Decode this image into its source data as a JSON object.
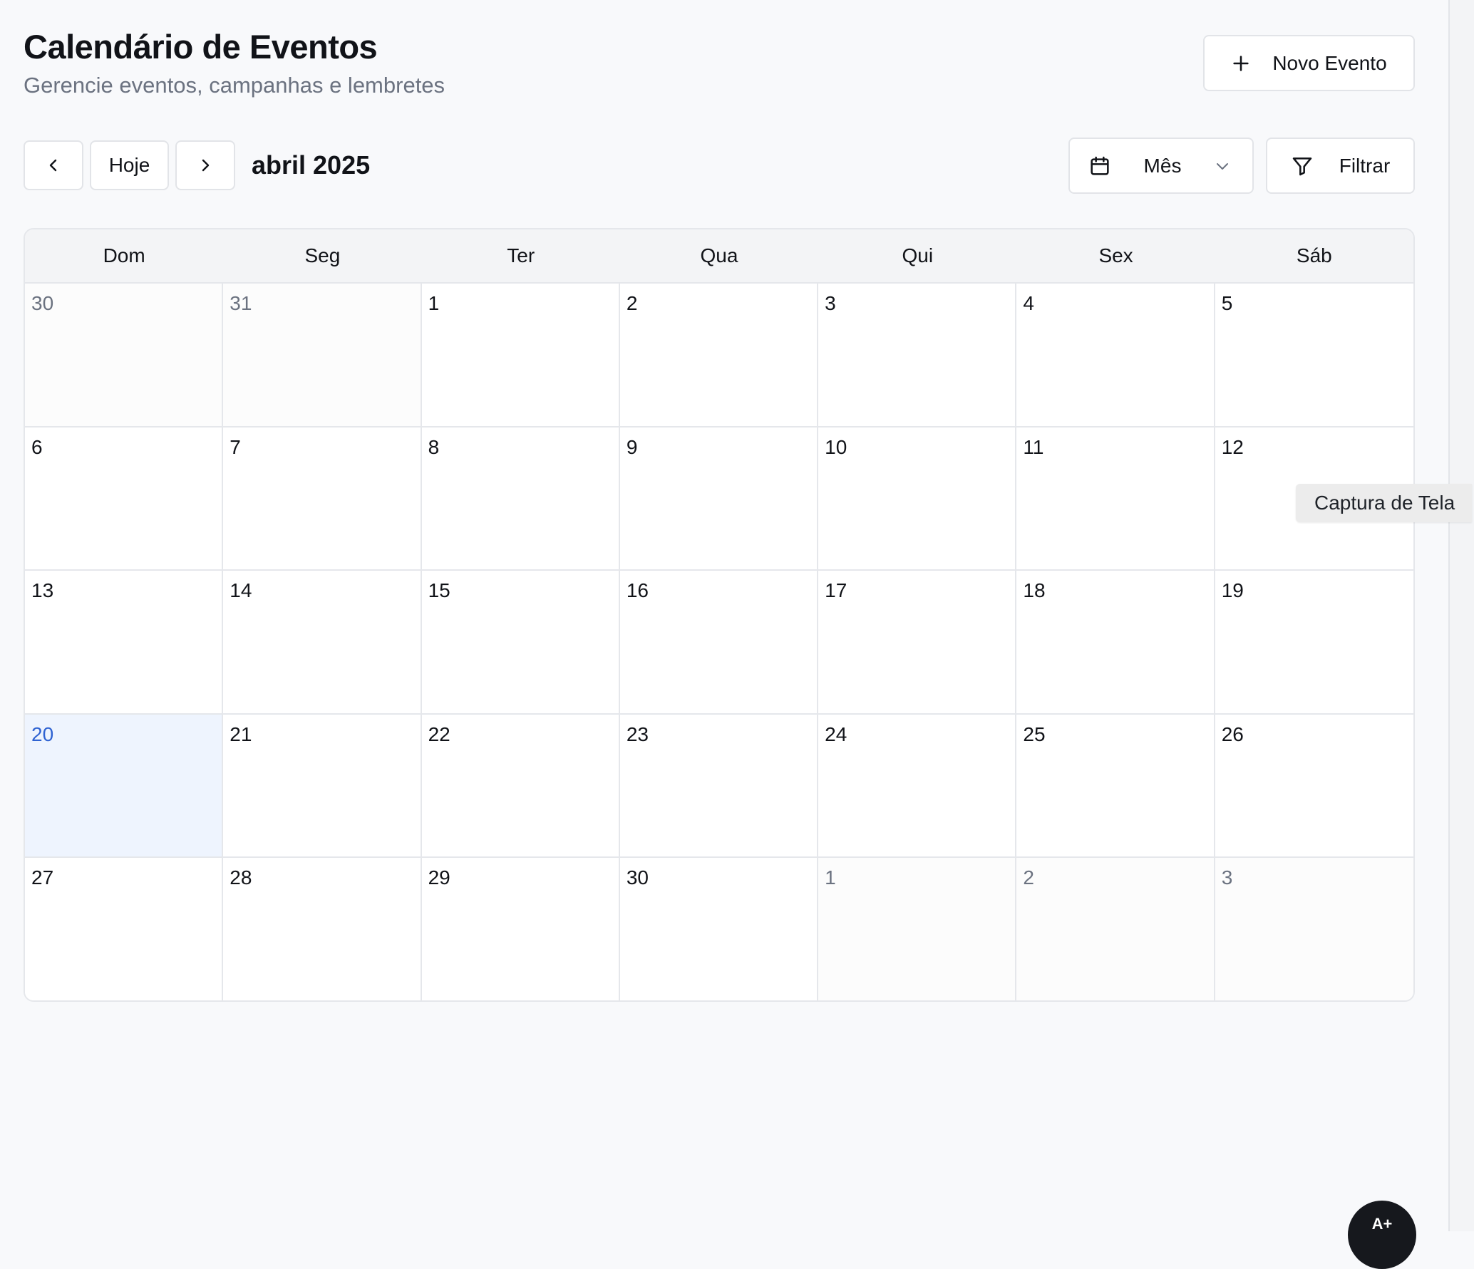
{
  "header": {
    "title": "Calendário de Eventos",
    "subtitle": "Gerencie eventos, campanhas e lembretes",
    "new_event_label": "Novo Evento"
  },
  "toolbar": {
    "today_label": "Hoje",
    "month_label": "abril 2025",
    "view_label": "Mês",
    "filter_label": "Filtrar"
  },
  "calendar": {
    "weekdays": [
      "Dom",
      "Seg",
      "Ter",
      "Qua",
      "Qui",
      "Sex",
      "Sáb"
    ],
    "weeks": [
      [
        {
          "day": "30",
          "outside": true
        },
        {
          "day": "31",
          "outside": true
        },
        {
          "day": "1"
        },
        {
          "day": "2"
        },
        {
          "day": "3"
        },
        {
          "day": "4"
        },
        {
          "day": "5"
        }
      ],
      [
        {
          "day": "6"
        },
        {
          "day": "7"
        },
        {
          "day": "8"
        },
        {
          "day": "9"
        },
        {
          "day": "10"
        },
        {
          "day": "11"
        },
        {
          "day": "12"
        }
      ],
      [
        {
          "day": "13"
        },
        {
          "day": "14"
        },
        {
          "day": "15"
        },
        {
          "day": "16"
        },
        {
          "day": "17"
        },
        {
          "day": "18"
        },
        {
          "day": "19"
        }
      ],
      [
        {
          "day": "20",
          "today": true
        },
        {
          "day": "21"
        },
        {
          "day": "22"
        },
        {
          "day": "23"
        },
        {
          "day": "24"
        },
        {
          "day": "25"
        },
        {
          "day": "26"
        }
      ],
      [
        {
          "day": "27"
        },
        {
          "day": "28"
        },
        {
          "day": "29"
        },
        {
          "day": "30"
        },
        {
          "day": "1",
          "outside": true
        },
        {
          "day": "2",
          "outside": true
        },
        {
          "day": "3",
          "outside": true
        }
      ]
    ]
  },
  "tooltip": {
    "text": "Captura de Tela"
  },
  "fab": {
    "label": "A+"
  },
  "icons": {
    "new_event": "plus-icon",
    "prev": "chevron-left-icon",
    "next": "chevron-right-icon",
    "view": "calendar-icon",
    "view_dropdown": "chevron-down-icon",
    "filter": "filter-icon"
  },
  "colors": {
    "today_background": "#eef4fe",
    "today_text": "#2f63d2",
    "outside_text": "#6b7280"
  }
}
